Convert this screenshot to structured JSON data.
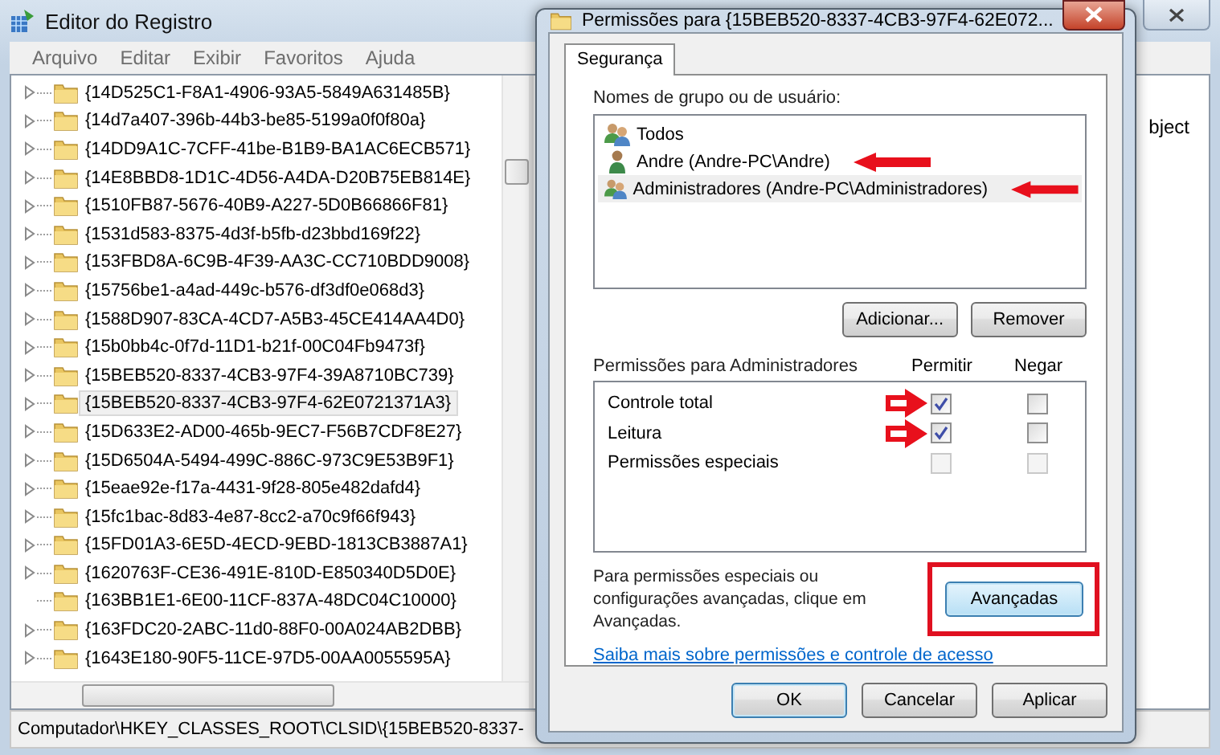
{
  "registry": {
    "title": "Editor do Registro",
    "menu": [
      "Arquivo",
      "Editar",
      "Exibir",
      "Favoritos",
      "Ajuda"
    ],
    "tree_items": [
      {
        "label": "{14D525C1-F8A1-4906-93A5-5849A631485B}",
        "selected": false,
        "expandable": true
      },
      {
        "label": "{14d7a407-396b-44b3-be85-5199a0f0f80a}",
        "selected": false,
        "expandable": true
      },
      {
        "label": "{14DD9A1C-7CFF-41be-B1B9-BA1AC6ECB571}",
        "selected": false,
        "expandable": true
      },
      {
        "label": "{14E8BBD8-1D1C-4D56-A4DA-D20B75EB814E}",
        "selected": false,
        "expandable": true
      },
      {
        "label": "{1510FB87-5676-40B9-A227-5D0B66866F81}",
        "selected": false,
        "expandable": true
      },
      {
        "label": "{1531d583-8375-4d3f-b5fb-d23bbd169f22}",
        "selected": false,
        "expandable": true
      },
      {
        "label": "{153FBD8A-6C9B-4F39-AA3C-CC710BDD9008}",
        "selected": false,
        "expandable": true
      },
      {
        "label": "{15756be1-a4ad-449c-b576-df3df0e068d3}",
        "selected": false,
        "expandable": true
      },
      {
        "label": "{1588D907-83CA-4CD7-A5B3-45CE414AA4D0}",
        "selected": false,
        "expandable": true
      },
      {
        "label": "{15b0bb4c-0f7d-11D1-b21f-00C04Fb9473f}",
        "selected": false,
        "expandable": true
      },
      {
        "label": "{15BEB520-8337-4CB3-97F4-39A8710BC739}",
        "selected": false,
        "expandable": true
      },
      {
        "label": "{15BEB520-8337-4CB3-97F4-62E0721371A3}",
        "selected": true,
        "expandable": true
      },
      {
        "label": "{15D633E2-AD00-465b-9EC7-F56B7CDF8E27}",
        "selected": false,
        "expandable": true
      },
      {
        "label": "{15D6504A-5494-499C-886C-973C9E53B9F1}",
        "selected": false,
        "expandable": true
      },
      {
        "label": "{15eae92e-f17a-4431-9f28-805e482dafd4}",
        "selected": false,
        "expandable": true
      },
      {
        "label": "{15fc1bac-8d83-4e87-8cc2-a70c9f66f943}",
        "selected": false,
        "expandable": true
      },
      {
        "label": "{15FD01A3-6E5D-4ECD-9EBD-1813CB3887A1}",
        "selected": false,
        "expandable": true
      },
      {
        "label": "{1620763F-CE36-491E-810D-E850340D5D0E}",
        "selected": false,
        "expandable": true
      },
      {
        "label": "{163BB1E1-6E00-11CF-837A-48DC04C10000}",
        "selected": false,
        "expandable": false
      },
      {
        "label": "{163FDC20-2ABC-11d0-88F0-00A024AB2DBB}",
        "selected": false,
        "expandable": true
      },
      {
        "label": "{1643E180-90F5-11CE-97D5-00AA0055595A}",
        "selected": false,
        "expandable": true
      }
    ],
    "right_pane_text": "bject",
    "status_bar": "Computador\\HKEY_CLASSES_ROOT\\CLSID\\{15BEB520-8337-"
  },
  "dialog": {
    "title": "Permissões para {15BEB520-8337-4CB3-97F4-62E072...",
    "tabs": [
      {
        "label": "Segurança",
        "selected": true
      }
    ],
    "users_label": "Nomes de grupo ou de usuário:",
    "users": [
      {
        "name": "Todos",
        "kind": "group",
        "selected": false,
        "annotated": false
      },
      {
        "name": "Andre (Andre-PC\\Andre)",
        "kind": "user",
        "selected": false,
        "annotated": true
      },
      {
        "name": "Administradores (Andre-PC\\Administradores)",
        "kind": "group",
        "selected": true,
        "annotated": true
      }
    ],
    "user_buttons": [
      "Adicionar...",
      "Remover"
    ],
    "permissions_label": "Permissões para Administradores",
    "columns": [
      "Permitir",
      "Negar"
    ],
    "permissions": [
      {
        "name": "Controle total",
        "annotated": true,
        "allow": {
          "checked": true,
          "disabled": false
        },
        "deny": {
          "checked": false,
          "disabled": false
        }
      },
      {
        "name": "Leitura",
        "annotated": true,
        "allow": {
          "checked": true,
          "disabled": false
        },
        "deny": {
          "checked": false,
          "disabled": false
        }
      },
      {
        "name": "Permissões especiais",
        "annotated": false,
        "allow": {
          "checked": false,
          "disabled": true
        },
        "deny": {
          "checked": false,
          "disabled": true
        }
      }
    ],
    "advanced_text": "Para permissões especiais ou configurações avançadas, clique em Avançadas.",
    "advanced_button": {
      "label": "Avançadas",
      "highlighted": true
    },
    "link": "Saiba mais sobre permissões e controle de acesso",
    "footer_buttons": [
      {
        "label": "OK",
        "default": true
      },
      {
        "label": "Cancelar",
        "default": false
      },
      {
        "label": "Aplicar",
        "default": false
      }
    ]
  }
}
